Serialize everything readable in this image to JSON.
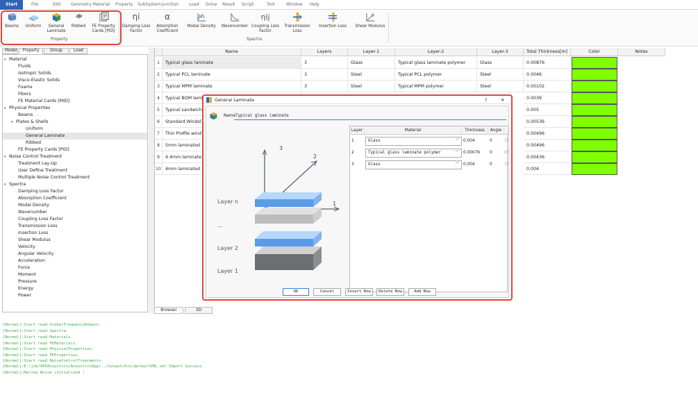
{
  "menu": {
    "items": [
      "Start",
      "File",
      "Edit",
      "Geometry",
      "Material",
      "Property",
      "SubSystem",
      "Junction",
      "Load",
      "Solve",
      "Result",
      "Script",
      "Tool",
      "Window",
      "Help"
    ],
    "active": "Start"
  },
  "ribbon": {
    "property_group": {
      "label": "Property",
      "buttons": [
        "Beams",
        "Uniform",
        "General Laminate",
        "Ribbed",
        "FE Property Cards [PID]"
      ]
    },
    "spectra_group": {
      "label": "Spectra",
      "buttons": [
        {
          "label": "Damping Loss Factor",
          "icon_text": "ηi"
        },
        {
          "label": "Absorption Coefficient",
          "icon_text": "α"
        },
        {
          "label": "Modal Density",
          "icon_text": ""
        },
        {
          "label": "Wavenumber",
          "icon_text": ""
        },
        {
          "label": "Coupling Loss Factor",
          "icon_text": "ηij"
        },
        {
          "label": "Transmission Loss",
          "icon_text": ""
        },
        {
          "label": "Insertion Loss",
          "icon_text": ""
        },
        {
          "label": "Shear Modulus",
          "icon_text": "G"
        }
      ]
    }
  },
  "left_tabs": [
    "Model",
    "Property",
    "Group",
    "Load"
  ],
  "tree": {
    "items": [
      {
        "label": "Material",
        "level": 0,
        "expanded": true
      },
      {
        "label": "Fluids",
        "level": 1
      },
      {
        "label": "Isotropic Solids",
        "level": 1
      },
      {
        "label": "Visco-Elastic Solids",
        "level": 1
      },
      {
        "label": "Foams",
        "level": 1
      },
      {
        "label": "Fibers",
        "level": 1
      },
      {
        "label": "FE Material Cards [MID]",
        "level": 1
      },
      {
        "label": "Physical Properties",
        "level": 0,
        "expanded": true
      },
      {
        "label": "Beams",
        "level": 1
      },
      {
        "label": "Plates & Shells",
        "level": 1,
        "expanded": true
      },
      {
        "label": "Uniform",
        "level": 2
      },
      {
        "label": "General Laminate",
        "level": 2,
        "selected": true
      },
      {
        "label": "Ribbed",
        "level": 2
      },
      {
        "label": "FE Property Cards [PID]",
        "level": 1
      },
      {
        "label": "Noise Control Treatment",
        "level": 0,
        "expanded": true
      },
      {
        "label": "Treatment Lay-Up",
        "level": 1
      },
      {
        "label": "User Define Treatment",
        "level": 1
      },
      {
        "label": "Multiple Noise Control Treatment",
        "level": 1
      },
      {
        "label": "Spectra",
        "level": 0,
        "expanded": true
      },
      {
        "label": "Damping Loss Factor",
        "level": 1
      },
      {
        "label": "Absorption Coefficient",
        "level": 1
      },
      {
        "label": "Modal Density",
        "level": 1
      },
      {
        "label": "Wavenumber",
        "level": 1
      },
      {
        "label": "Coupling Loss Factor",
        "level": 1
      },
      {
        "label": "Transmission Loss",
        "level": 1
      },
      {
        "label": "Insertion Loss",
        "level": 1
      },
      {
        "label": "Shear Modulus",
        "level": 1
      },
      {
        "label": "Velocity",
        "level": 1
      },
      {
        "label": "Angular Velocity",
        "level": 1
      },
      {
        "label": "Acceleration",
        "level": 1
      },
      {
        "label": "Force",
        "level": 1
      },
      {
        "label": "Moment",
        "level": 1
      },
      {
        "label": "Pressure",
        "level": 1
      },
      {
        "label": "Energy",
        "level": 1
      },
      {
        "label": "Power",
        "level": 1
      }
    ]
  },
  "table": {
    "headers": [
      "Name",
      "Layers",
      "Layer-1",
      "Layer-2",
      "Layer-3",
      "Total Thickness[m]",
      "Color",
      "Notes"
    ],
    "rows": [
      {
        "num": "1",
        "name": "Typical glass laminate",
        "layers": "3",
        "l1": "Glass",
        "l2": "Typical glass laminate polymer",
        "l3": "Glass",
        "thick": "0.00876"
      },
      {
        "num": "2",
        "name": "Typical PCL laminate",
        "layers": "3",
        "l1": "Steel",
        "l2": "Typical PCL polymer",
        "l3": "Steel",
        "thick": "0.0046"
      },
      {
        "num": "3",
        "name": "Typical MPM laminate",
        "layers": "3",
        "l1": "Steel",
        "l2": "Typical MPM polymer",
        "l3": "Steel",
        "thick": "0.00102"
      },
      {
        "num": "4",
        "name": "Typical BOM laminate",
        "layers": "",
        "l1": "",
        "l2": "",
        "l3": "",
        "thick": "0.0039"
      },
      {
        "num": "5",
        "name": "Typical sandwich",
        "layers": "",
        "l1": "",
        "l2": "",
        "l3": "",
        "thick": "0.005"
      },
      {
        "num": "6",
        "name": "Standard Windsl",
        "layers": "",
        "l1": "",
        "l2": "",
        "l3": "",
        "thick": "0.00536"
      },
      {
        "num": "7",
        "name": "Thin Profile wind",
        "layers": "",
        "l1": "",
        "l2": "",
        "l3": "",
        "thick": "0.00496"
      },
      {
        "num": "8",
        "name": "5mm laminated",
        "layers": "",
        "l1": "",
        "l2": "",
        "l3": "",
        "thick": "0.00496"
      },
      {
        "num": "9",
        "name": "4.4mm laminate",
        "layers": "",
        "l1": "",
        "l2": "",
        "l3": "",
        "thick": "0.00436"
      },
      {
        "num": "10",
        "name": "4mm laminated",
        "layers": "",
        "l1": "",
        "l2": "",
        "l3": "",
        "thick": "0.004"
      }
    ],
    "row_color": "#80ff00"
  },
  "bottom_tabs": [
    "Browser",
    "3D"
  ],
  "console": {
    "lines": [
      "[Normal]:Start read GlobalFrequencyDomain.",
      "[Normal]:Start read Spectra.",
      "[Normal]:Start read Materials.",
      "[Normal]:Start read FEMaterials.",
      "[Normal]:Start read PhysicalProperties.",
      "[Normal]:Start read FEProperties.",
      "[Normal]:Start read NoiseControlTreatments.",
      "[Normal]:E:/job/APPAcoustics/AcousticsApp/../output/bin/defaultXML.xml Import Success.",
      "[Normal]:Marine Noise initialized !"
    ]
  },
  "dialog": {
    "title": "General Laminate",
    "help": "?",
    "close": "✕",
    "name_label": "Name",
    "name_value": "Typical glass laminate",
    "diagram": {
      "axis_labels": [
        "3",
        "2",
        "1"
      ],
      "layer_labels": [
        "Layer n",
        "...",
        "Layer 2",
        "Layer 1"
      ]
    },
    "grid": {
      "headers": [
        "Layer",
        "Material",
        "Thickness",
        "Angle",
        ""
      ],
      "rows": [
        {
          "layer": "1",
          "material": "Glass",
          "thickness": "0.004",
          "angle": "0",
          "extra": "1%"
        },
        {
          "layer": "2",
          "material": "Typical glass laminate polymer",
          "thickness": "0.00076",
          "angle": "0",
          "extra": "0%"
        },
        {
          "layer": "3",
          "material": "Glass",
          "thickness": "0.004",
          "angle": "0",
          "extra": "1%"
        }
      ]
    },
    "buttons": {
      "ok": "OK",
      "cancel": "Cancel",
      "insert": "Insert Row",
      "delete": "Delete Row",
      "add": "Add Row"
    }
  }
}
